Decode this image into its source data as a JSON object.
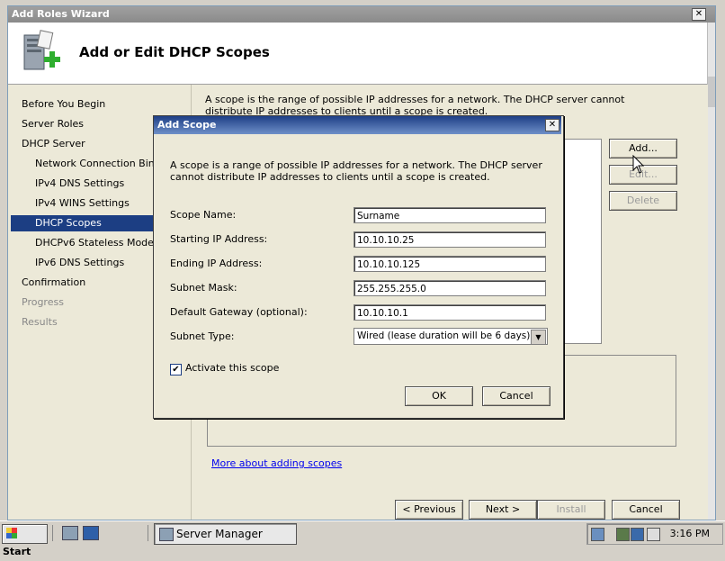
{
  "wizard": {
    "title": "Add Roles Wizard",
    "close_glyph": "✕",
    "header_title": "Add or Edit DHCP Scopes",
    "nav_items": [
      {
        "label": "Before You Begin",
        "state": "normal"
      },
      {
        "label": "Server Roles",
        "state": "normal"
      },
      {
        "label": "DHCP Server",
        "state": "normal"
      },
      {
        "label": "Network Connection Bindings",
        "state": "normal"
      },
      {
        "label": "IPv4 DNS Settings",
        "state": "normal"
      },
      {
        "label": "IPv4 WINS Settings",
        "state": "normal"
      },
      {
        "label": "DHCP Scopes",
        "state": "selected"
      },
      {
        "label": "DHCPv6 Stateless Mode",
        "state": "normal"
      },
      {
        "label": "IPv6 DNS Settings",
        "state": "normal"
      },
      {
        "label": "Confirmation",
        "state": "normal"
      },
      {
        "label": "Progress",
        "state": "disabled"
      },
      {
        "label": "Results",
        "state": "disabled"
      }
    ],
    "description": "A scope is the range of possible IP addresses for a network. The DHCP server cannot distribute IP addresses to clients until a scope is created.",
    "add_button": "Add...",
    "edit_button": "Edit...",
    "delete_button": "Delete",
    "more_link": "More about adding scopes",
    "previous_button": "< Previous",
    "next_button": "Next >",
    "install_button": "Install",
    "cancel_button": "Cancel"
  },
  "dialog": {
    "title": "Add Scope",
    "close_glyph": "✕",
    "description": "A scope is a range of possible IP addresses for a network. The DHCP server cannot distribute IP addresses to clients until a scope is created.",
    "scope_name_label": "Scope Name:",
    "scope_name_value": "Surname",
    "start_ip_label": "Starting IP Address:",
    "start_ip_value": "10.10.10.25",
    "end_ip_label": "Ending IP Address:",
    "end_ip_value": "10.10.10.125",
    "subnet_mask_label": "Subnet Mask:",
    "subnet_mask_value": "255.255.255.0",
    "gateway_label": "Default Gateway (optional):",
    "gateway_value": "10.10.10.1",
    "subnet_type_label": "Subnet Type:",
    "subnet_type_value": "Wired (lease duration will be 6 days)",
    "activate_label": "Activate this scope",
    "activate_checked": true,
    "checkmark_glyph": "✔",
    "dropdown_glyph": "▼",
    "ok_button": "OK",
    "cancel_button": "Cancel"
  },
  "taskbar": {
    "start_label": "Start",
    "task_label": "Server Manager",
    "clock": "3:16 PM"
  },
  "colors": {
    "selection": "#1c3e83",
    "dialog_title": "#1e3f86",
    "link": "#0000ee"
  }
}
